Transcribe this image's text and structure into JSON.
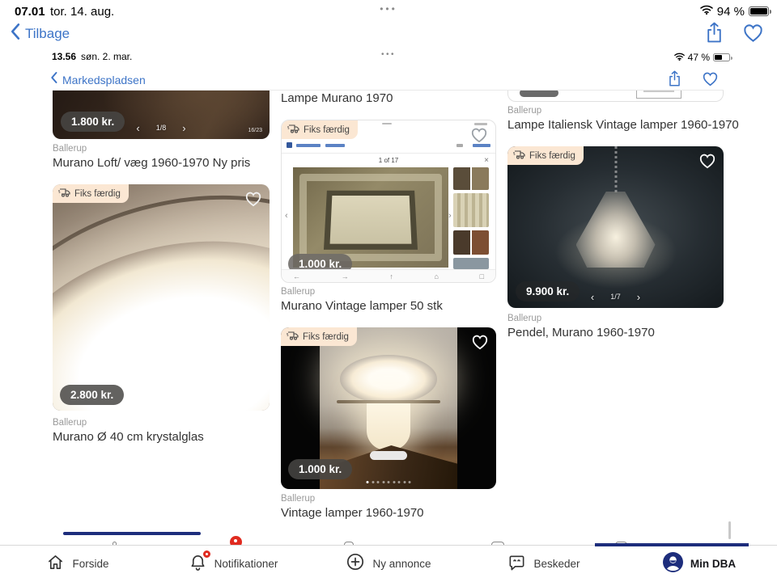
{
  "glyphs": {
    "dots": "•••",
    "arrow_left": "‹",
    "arrow_right": "›",
    "close": "×"
  },
  "outer_status": {
    "time": "07.01",
    "date": "tor. 14. aug.",
    "battery": "94 %"
  },
  "outer_nav": {
    "back_label": "Tilbage"
  },
  "inner_status": {
    "time": "13.56",
    "date": "søn. 2. mar.",
    "battery": "47 %"
  },
  "inner_nav": {
    "back_label": "Markedspladsen"
  },
  "fiks_badge_label": "Fiks færdig",
  "listings": {
    "col1_top": {
      "price": "1.800 kr.",
      "carousel": "1/8",
      "counter": "16/23",
      "location": "Ballerup",
      "title": "Murano Loft/ væg 1960-1970 Ny pris"
    },
    "col1_main": {
      "price": "2.800 kr.",
      "location": "Ballerup",
      "title": "Murano Ø 40 cm krystalglas"
    },
    "col2_prev_title": "Lampe Murano 1970",
    "col2_web": {
      "price": "1.000 kr.",
      "page_counter": "1 of 17",
      "location": "Ballerup",
      "title": "Murano Vintage lamper 50 stk"
    },
    "col2_mushroom": {
      "price": "1.000 kr.",
      "location": "Ballerup",
      "title": "Vintage lamper 1960-1970"
    },
    "col3_prev": {
      "location": "Ballerup",
      "title": "Lampe Italiensk Vintage lamper 1960-1970"
    },
    "col3_pendant": {
      "price": "9.900 kr.",
      "carousel": "1/7",
      "location": "Ballerup",
      "title": "Pendel, Murano 1960-1970"
    }
  },
  "tabbar": {
    "items": [
      {
        "label": "Forside"
      },
      {
        "label": "Notifikationer"
      },
      {
        "label": "Ny annonce"
      },
      {
        "label": "Beskeder"
      },
      {
        "label": "Min DBA"
      }
    ]
  },
  "colors": {
    "link_blue": "#3d74c7",
    "navy": "#1d2d7c",
    "badge_red": "#e02b20",
    "fiks_bg": "#fbe7d3"
  }
}
